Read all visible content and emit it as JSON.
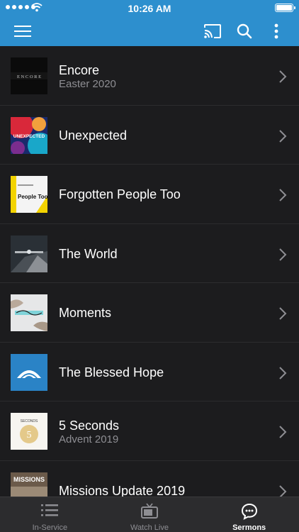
{
  "status_bar": {
    "time": "10:26 AM"
  },
  "nav": {
    "icons": [
      "menu-icon",
      "cast-icon",
      "search-icon",
      "more-vertical-icon"
    ]
  },
  "sermons": [
    {
      "title": "Encore",
      "subtitle": "Easter 2020",
      "art": "encore",
      "art_label": "E N C O R E"
    },
    {
      "title": "Unexpected",
      "subtitle": "",
      "art": "unexpected",
      "art_label": "UNEXPECTED"
    },
    {
      "title": "Forgotten People Too",
      "subtitle": "",
      "art": "forgotten",
      "art_label": "People Too"
    },
    {
      "title": "The World",
      "subtitle": "",
      "art": "world",
      "art_label": ""
    },
    {
      "title": "Moments",
      "subtitle": "",
      "art": "moments",
      "art_label": ""
    },
    {
      "title": "The Blessed Hope",
      "subtitle": "",
      "art": "hope",
      "art_label": ""
    },
    {
      "title": "5 Seconds",
      "subtitle": "Advent 2019",
      "art": "seconds",
      "art_label": "SECONDS"
    },
    {
      "title": "Missions Update 2019",
      "subtitle": "",
      "art": "missions",
      "art_label": "MISSIONS"
    }
  ],
  "tabs": [
    {
      "label": "In-Service",
      "icon": "list-icon",
      "active": false
    },
    {
      "label": "Watch Live",
      "icon": "tv-icon",
      "active": false
    },
    {
      "label": "Sermons",
      "icon": "chat-bubble-icon",
      "active": true
    }
  ],
  "colors": {
    "nav_bar": "#2d8fce",
    "background": "#1c1c1e",
    "tab_bar": "#2c2c2e",
    "subtitle": "#8e8e93"
  }
}
